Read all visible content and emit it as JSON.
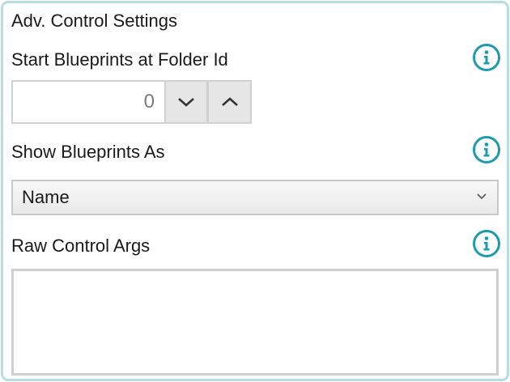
{
  "panel": {
    "title": "Adv. Control Settings"
  },
  "fields": {
    "start_folder": {
      "label": "Start Blueprints at Folder Id",
      "value": "0",
      "info_icon": "info-icon",
      "decrement_icon": "chevron-down-icon",
      "increment_icon": "chevron-up-icon"
    },
    "show_as": {
      "label": "Show Blueprints As",
      "selected": "Name",
      "info_icon": "info-icon",
      "dropdown_icon": "chevron-down-icon"
    },
    "raw_args": {
      "label": "Raw Control Args",
      "value": "",
      "info_icon": "info-icon"
    }
  },
  "colors": {
    "accent": "#1a9bb0",
    "panel_border": "#b5dde3"
  }
}
